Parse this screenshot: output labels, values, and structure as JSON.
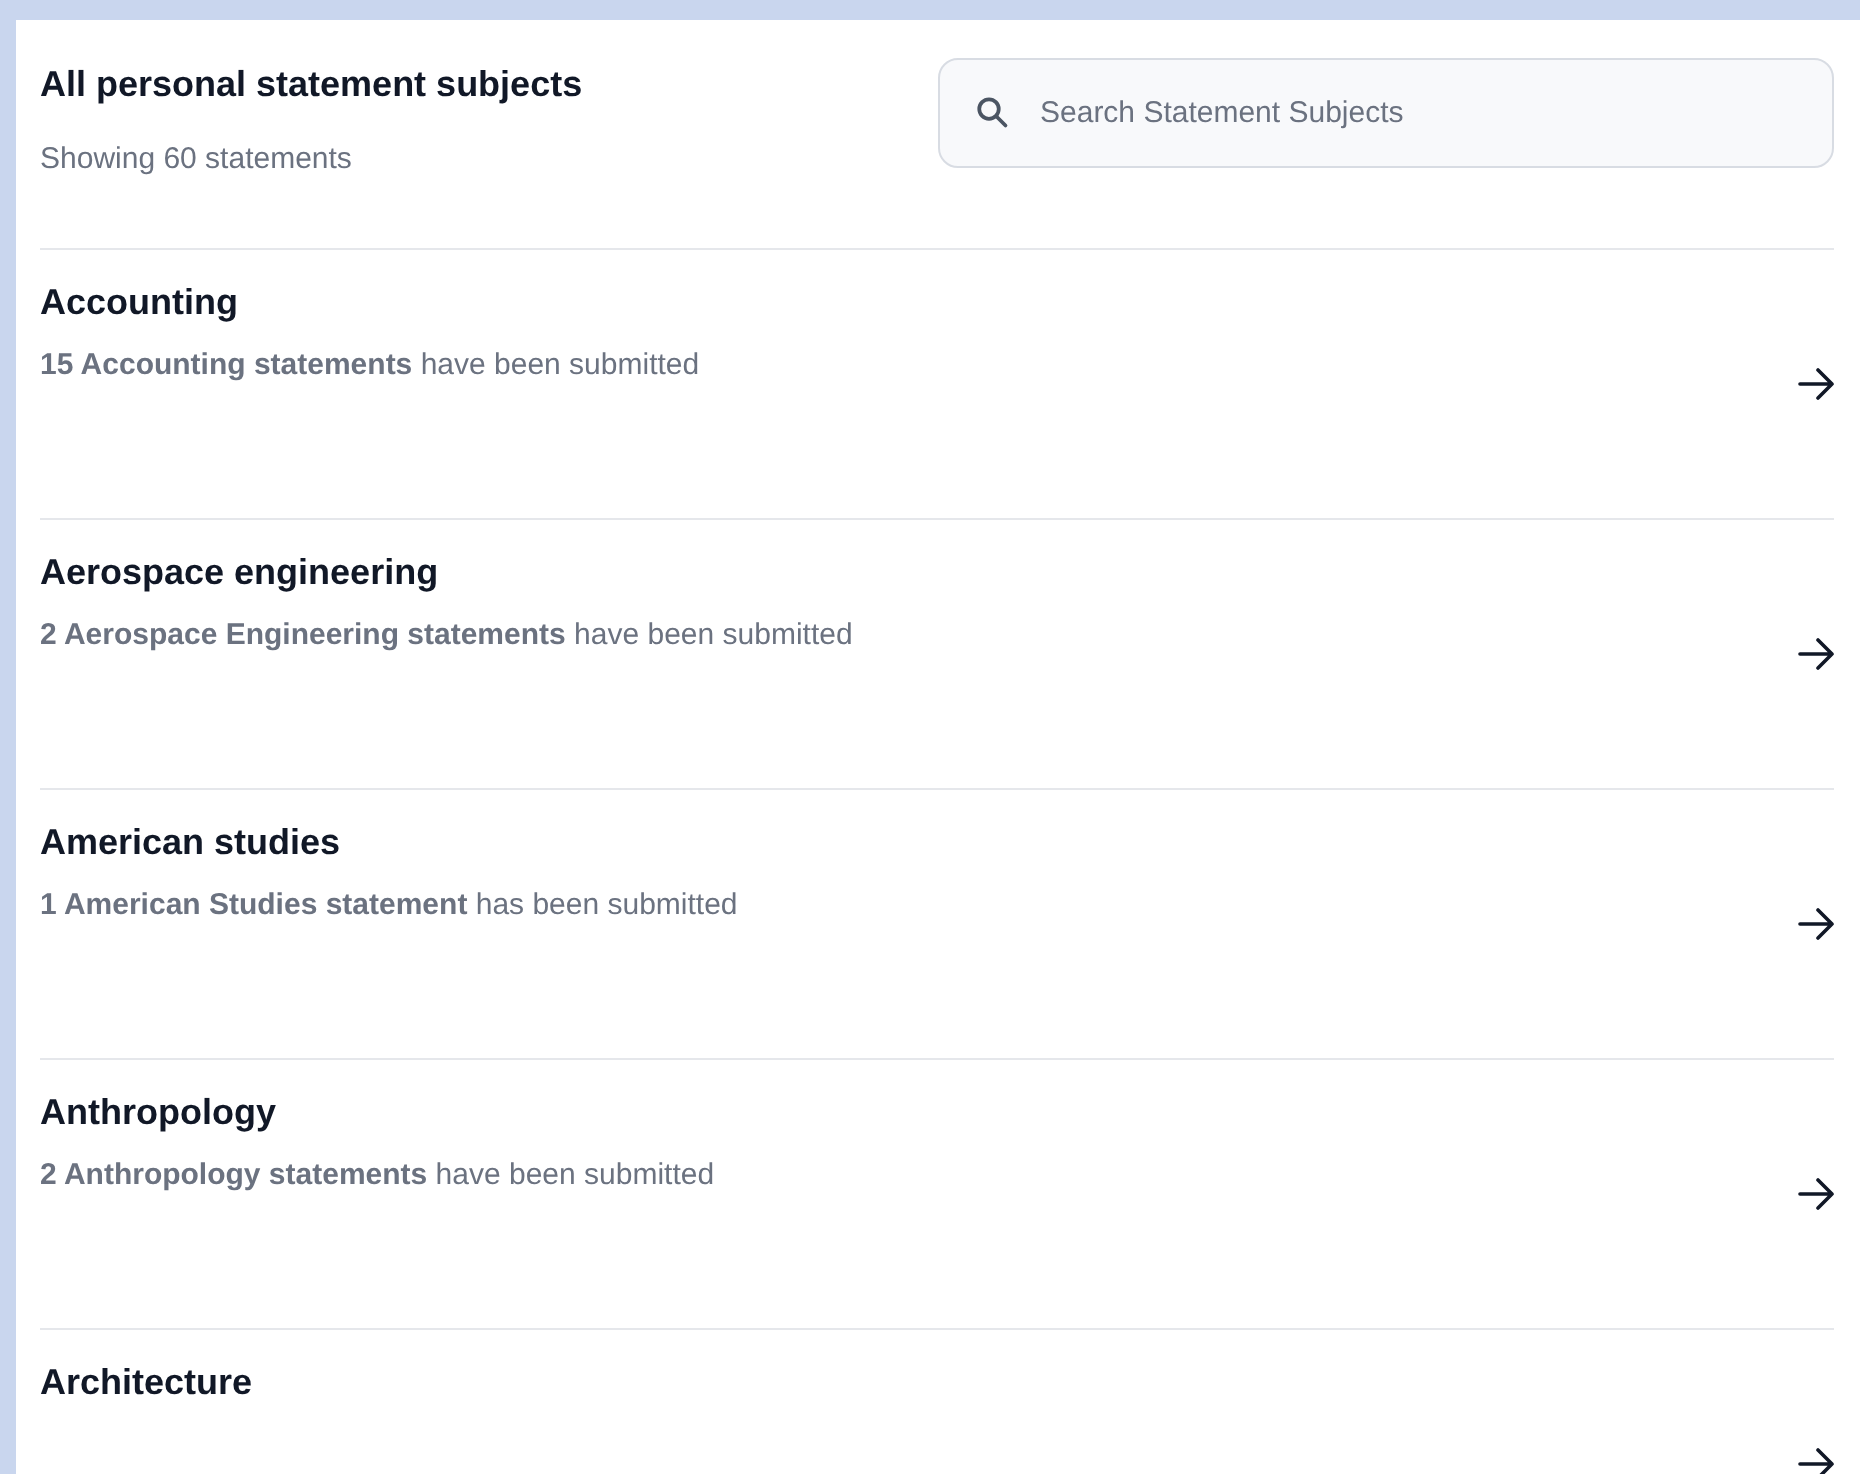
{
  "header": {
    "title": "All personal statement subjects",
    "count": "Showing 60 statements"
  },
  "search": {
    "placeholder": "Search Statement Subjects"
  },
  "subjects": [
    {
      "name": "Accounting",
      "summary": "**15 Accounting statements** have been submitted"
    },
    {
      "name": "Aerospace engineering",
      "summary": "**2 Aerospace Engineering statements** have been submitted"
    },
    {
      "name": "American studies",
      "summary": "**1 American Studies statement** has been submitted"
    },
    {
      "name": "Anthropology",
      "summary": "**2 Anthropology statements** have been submitted"
    },
    {
      "name": "Architecture"
    }
  ]
}
